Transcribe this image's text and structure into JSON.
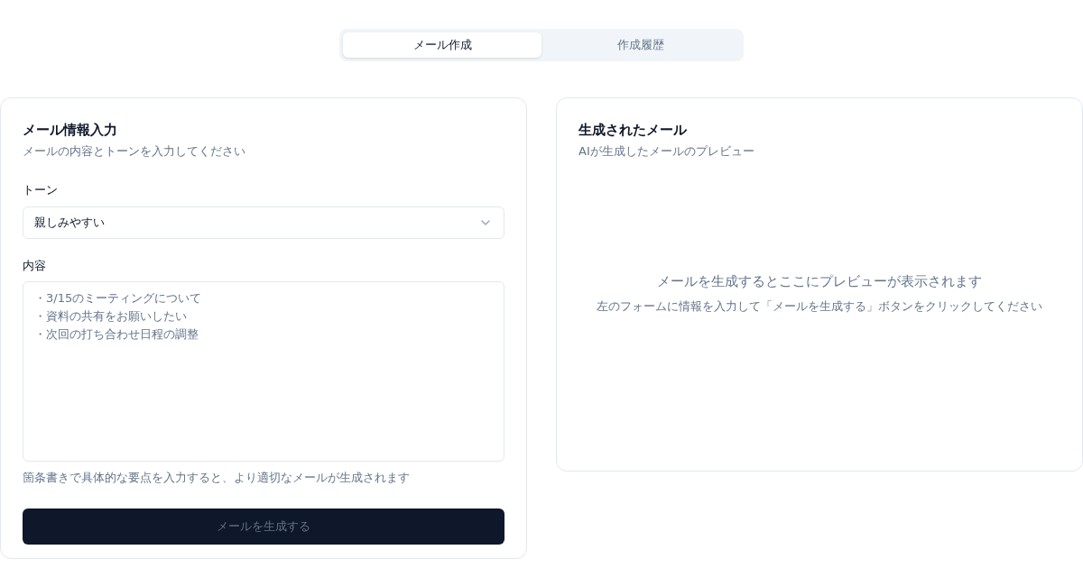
{
  "tabs": [
    {
      "label": "メール作成",
      "selected": true
    },
    {
      "label": "作成履歴",
      "selected": false
    }
  ],
  "input_card": {
    "title": "メール情報入力",
    "subtitle": "メールの内容とトーンを入力してください",
    "tone": {
      "label": "トーン",
      "value": "親しみやすい"
    },
    "content": {
      "label": "内容",
      "placeholder_lines": [
        "・3/15のミーティングについて",
        "・資料の共有をお願いしたい",
        "・次回の打ち合わせ日程の調整"
      ],
      "hint": "箇条書きで具体的な要点を入力すると、より適切なメールが生成されます"
    },
    "generate_button": {
      "label": "メールを生成する",
      "disabled": true
    }
  },
  "preview_card": {
    "title": "生成されたメール",
    "subtitle": "AIが生成したメールのプレビュー",
    "empty_title": "メールを生成するとここにプレビューが表示されます",
    "empty_text": "左のフォームに情報を入力して「メールを生成する」ボタンをクリックしてください"
  }
}
